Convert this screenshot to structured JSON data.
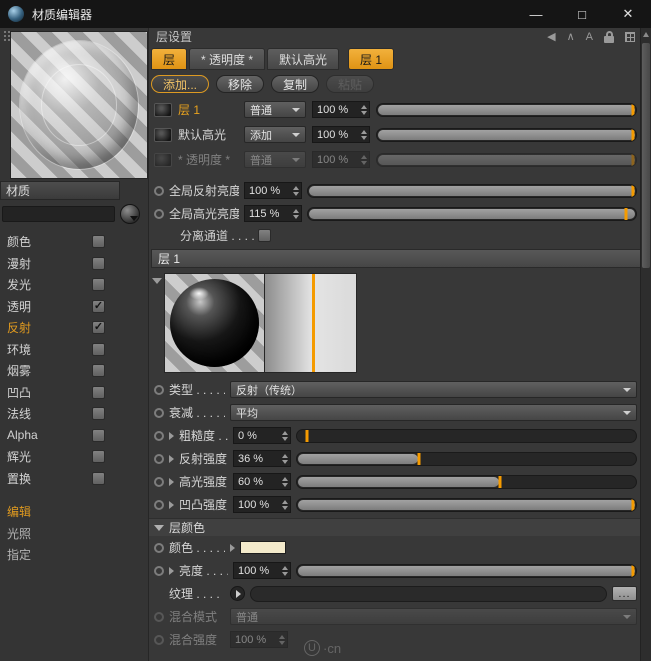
{
  "window": {
    "title": "材质编辑器",
    "minimize": "—",
    "maximize": "□",
    "close": "✕"
  },
  "nav": {
    "back_glyph": "◀",
    "caret_glyph": "∧",
    "letter_glyph": "A"
  },
  "left": {
    "material_label": "材质",
    "channels": [
      {
        "label": "颜色",
        "check": ""
      },
      {
        "label": "漫射",
        "check": ""
      },
      {
        "label": "发光",
        "check": ""
      },
      {
        "label": "透明",
        "check": "✓"
      },
      {
        "label": "反射",
        "check": "✓"
      },
      {
        "label": "环境",
        "check": ""
      },
      {
        "label": "烟雾",
        "check": ""
      },
      {
        "label": "凹凸",
        "check": ""
      },
      {
        "label": "法线",
        "check": ""
      },
      {
        "label": "Alpha",
        "check": ""
      },
      {
        "label": "辉光",
        "check": ""
      },
      {
        "label": "置换",
        "check": ""
      }
    ],
    "pages": [
      {
        "label": "编辑"
      },
      {
        "label": "光照"
      },
      {
        "label": "指定"
      }
    ]
  },
  "main": {
    "section_title": "层设置",
    "tabs": [
      {
        "label": "层"
      },
      {
        "label": "* 透明度 *"
      },
      {
        "label": "默认高光"
      },
      {
        "label": "层 1"
      }
    ],
    "buttons": {
      "add": "添加...",
      "remove": "移除",
      "copy": "复制",
      "paste": "粘贴"
    },
    "layers": [
      {
        "name": "层 1",
        "mode": "普通",
        "value": "100 %",
        "pct": 100,
        "marker": 99
      },
      {
        "name": "默认高光",
        "mode": "添加",
        "value": "100 %",
        "pct": 100,
        "marker": 99
      },
      {
        "name": "* 透明度 *",
        "mode": "普通",
        "value": "100 %",
        "pct": 100,
        "marker": 99
      }
    ],
    "globals": [
      {
        "label": "全局反射亮度",
        "value": "100 %",
        "pct": 100,
        "marker": 99
      },
      {
        "label": "全局高光亮度",
        "value": "115 %",
        "pct": 100,
        "marker": 97
      }
    ],
    "separate_label": "分离通道 . . . .",
    "layer_header": "层 1",
    "type_row": {
      "label": "类型 . . . . . .",
      "value": "反射（传统）"
    },
    "falloff_row": {
      "label": "衰减 . . . . . .",
      "value": "平均"
    },
    "sliders": [
      {
        "label": "粗糙度 . .",
        "value": "0 %",
        "pct": 0,
        "marker": 3
      },
      {
        "label": "反射强度 . .",
        "value": "36 %",
        "pct": 36,
        "marker": 36
      },
      {
        "label": "高光强度 . .",
        "value": "60 %",
        "pct": 60,
        "marker": 60
      },
      {
        "label": "凹凸强度 . .",
        "value": "100 %",
        "pct": 100,
        "marker": 99
      }
    ],
    "layer_color": {
      "header": "层颜色",
      "color_label": "颜色 . . . . .",
      "swatch_color": "#f3eacb",
      "brightness_label": "亮度 . . . .",
      "brightness_value": "100 %",
      "brightness_pct": 100,
      "brightness_marker": 99,
      "texture_label": "纹理 . . . .",
      "more_button": "...",
      "mix_mode_label": "混合模式",
      "mix_mode_value": "普通",
      "mix_strength_label": "混合强度",
      "mix_strength_value": "100 %"
    },
    "watermark": {
      "u": "U",
      "rest": "·cn"
    }
  }
}
